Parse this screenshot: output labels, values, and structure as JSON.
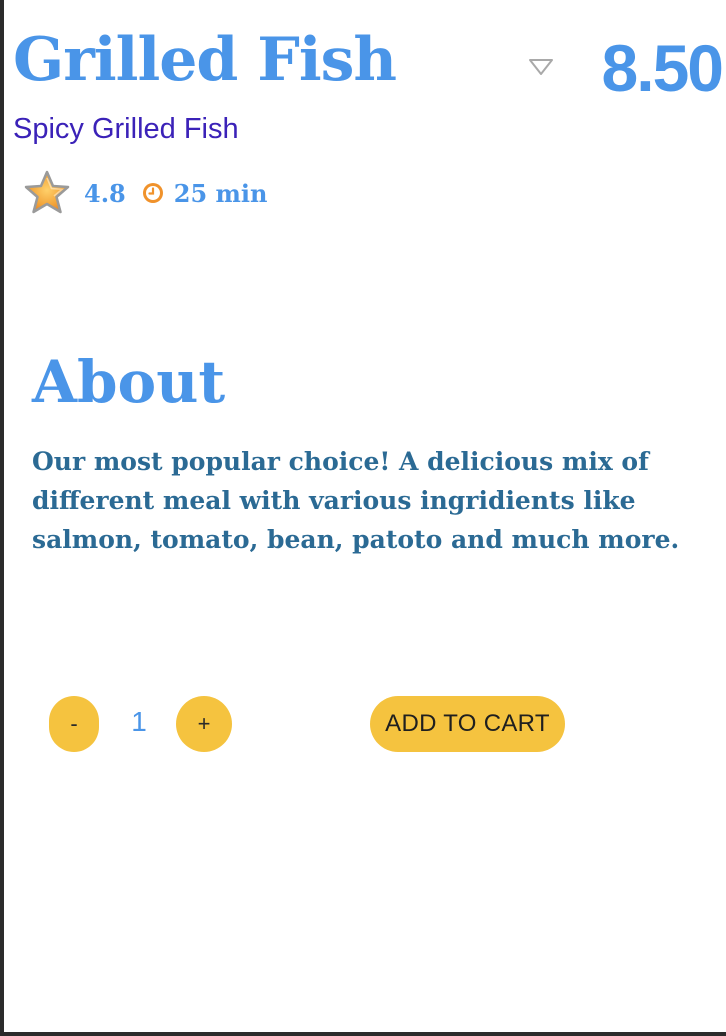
{
  "product": {
    "name": "Grilled Fish",
    "price": "8.50",
    "subtitle": "Spicy Grilled Fish",
    "rating": "4.8",
    "duration": "25 min"
  },
  "about": {
    "heading": "About",
    "text": "Our most popular choice! A delicious mix of different meal with various ingridients like salmon, tomato, bean, patoto and much more."
  },
  "quantity": {
    "minus_label": "-",
    "value": "1",
    "plus_label": "+"
  },
  "actions": {
    "add_to_cart_label": "ADD TO CART"
  },
  "icons": {
    "price_dropdown": "caret-down-icon",
    "rating": "star-icon",
    "duration": "clock-icon"
  },
  "colors": {
    "accent_blue": "#4a95e8",
    "subtitle_purple": "#3b22b8",
    "body_text": "#2b6a94",
    "button_yellow": "#f5c33f",
    "clock_orange": "#f0922b"
  }
}
